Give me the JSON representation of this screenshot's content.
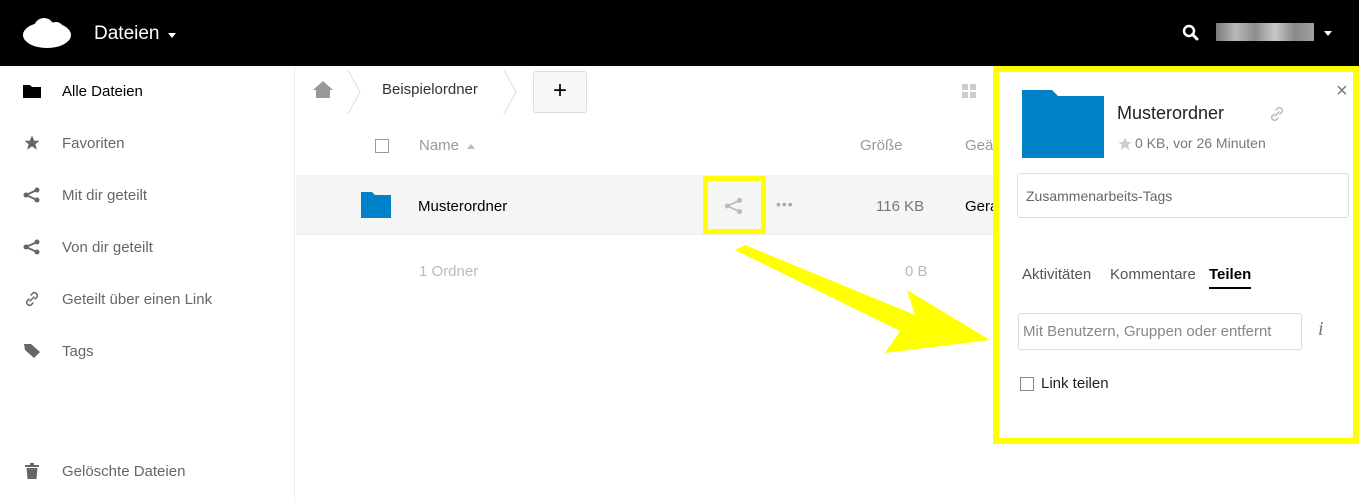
{
  "header": {
    "app_menu_label": "Dateien",
    "icons": {
      "logo": "cloud-logo-icon",
      "search": "search-icon",
      "dropdown": "chevron-down-icon"
    },
    "colors": {
      "bar": "#000000"
    }
  },
  "sidebar": {
    "items": [
      {
        "label": "Alle Dateien",
        "icon": "folder-icon",
        "active": true
      },
      {
        "label": "Favoriten",
        "icon": "star-icon",
        "active": false
      },
      {
        "label": "Mit dir geteilt",
        "icon": "share-icon",
        "active": false
      },
      {
        "label": "Von dir geteilt",
        "icon": "share-icon",
        "active": false
      },
      {
        "label": "Geteilt über einen Link",
        "icon": "link-icon",
        "active": false
      },
      {
        "label": "Tags",
        "icon": "tag-icon",
        "active": false
      }
    ],
    "trash_label": "Gelöschte Dateien"
  },
  "breadcrumb": {
    "home_icon": "home-icon",
    "folder": "Beispielordner",
    "new_button": "+"
  },
  "file_list": {
    "columns": {
      "name": "Name",
      "size": "Größe",
      "modified": "Geä"
    },
    "rows": [
      {
        "name": "Musterordner",
        "size": "116 KB",
        "modified": "Gera",
        "more": "•••"
      }
    ],
    "summary": {
      "label": "1 Ordner",
      "size": "0 B"
    }
  },
  "details": {
    "close": "×",
    "title": "Musterordner",
    "meta": "0 KB, vor 26 Minuten",
    "tags_placeholder": "Zusammenarbeits-Tags",
    "tabs": [
      {
        "label": "Aktivitäten",
        "active": false
      },
      {
        "label": "Kommentare",
        "active": false
      },
      {
        "label": "Teilen",
        "active": true
      }
    ],
    "share_placeholder": "Mit Benutzern, Gruppen oder entfernt",
    "info_icon": "i",
    "link_share_label": "Link teilen"
  },
  "colors": {
    "folder": "#0082c9",
    "highlight": "#ffff00"
  }
}
